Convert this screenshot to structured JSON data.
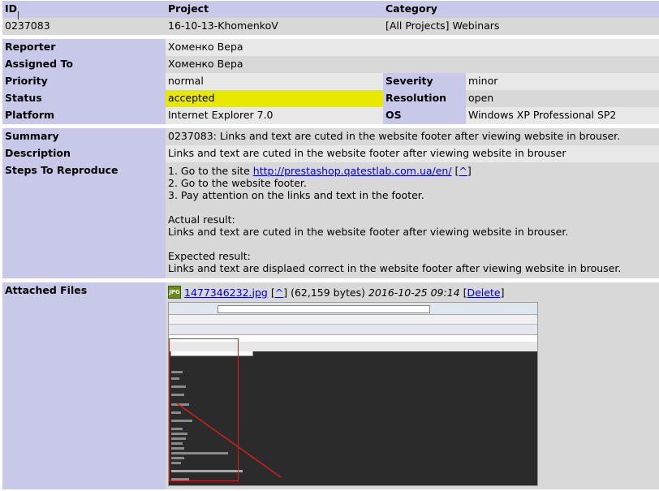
{
  "header": {
    "id_label": "ID",
    "project_label": "Project",
    "category_label": "Category",
    "id_value": "0237083",
    "project_value": "16-10-13-KhomenkoV",
    "category_value": "[All Projects] Webinars"
  },
  "fields": {
    "reporter_label": "Reporter",
    "reporter_value": "Хоменко Вера",
    "assigned_label": "Assigned To",
    "assigned_value": "Хоменко Вера",
    "priority_label": "Priority",
    "priority_value": "normal",
    "severity_label": "Severity",
    "severity_value": "minor",
    "status_label": "Status",
    "status_value": "accepted",
    "resolution_label": "Resolution",
    "resolution_value": "open",
    "platform_label": "Platform",
    "platform_value": "Internet Explorer 7.0",
    "os_label": "OS",
    "os_value": "Windows XP Professional SP2"
  },
  "details": {
    "summary_label": "Summary",
    "summary_value": "0237083: Links and text are cuted in the website footer after viewing website in brouser.",
    "description_label": "Description",
    "description_value": "Links and text are cuted in the website footer after viewing website in brouser",
    "steps_label": "Steps To Reproduce",
    "step1_prefix": "1. Go to the site ",
    "step1_link": "http://prestashop.qatestlab.com.ua/en/",
    "step1_bracket_open": " [",
    "step1_caret": "^",
    "step1_bracket_close": "]",
    "step2": "2. Go to the website footer.",
    "step3": "3. Pay attention on the links and text in the footer.",
    "actual_label": "Actual result:",
    "actual_text": "Links and text are cuted in the website footer after viewing website in brouser.",
    "expected_label": "Expected result:",
    "expected_text": "Links and text are displaed correct in the website footer after viewing website in brouser."
  },
  "attachments": {
    "label": "Attached Files",
    "file_icon": "image-file-icon",
    "file_name": "1477346232.jpg",
    "bracket_open": " [",
    "caret": "^",
    "bracket_close": "]",
    "file_size": " (62,159 bytes) ",
    "file_date": "2016-10-25 09:14",
    "delete_open": " [",
    "delete_label": "Delete",
    "delete_close": "]"
  },
  "colors": {
    "label_bg": "#c8c8e8",
    "row_dark": "#d8d8d8",
    "row_light": "#e8e8e8",
    "status_accepted": "#e8e800",
    "link": "#0000cc"
  }
}
